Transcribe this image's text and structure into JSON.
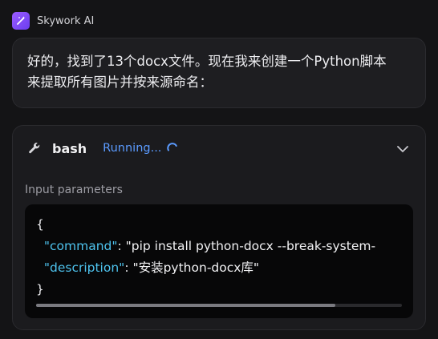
{
  "app": {
    "name": "Skywork AI",
    "logo_icon": "magic-wand-icon",
    "brand_color": "#8a4dff"
  },
  "message": {
    "line1": "好的，找到了13个docx文件。现在我来创建一个Python脚本",
    "line2": "来提取所有图片并按来源命名："
  },
  "tool": {
    "icon": "wrench-icon",
    "name": "bash",
    "status": "Running...",
    "status_color": "#5b9bff",
    "params_label": "Input parameters",
    "code": {
      "open": "{",
      "close": "}",
      "command_key": "\"command\"",
      "command_value": "\"pip install python-docx --break-system-",
      "description_key": "\"description\"",
      "description_value": "\"安装python-docx库\""
    }
  }
}
